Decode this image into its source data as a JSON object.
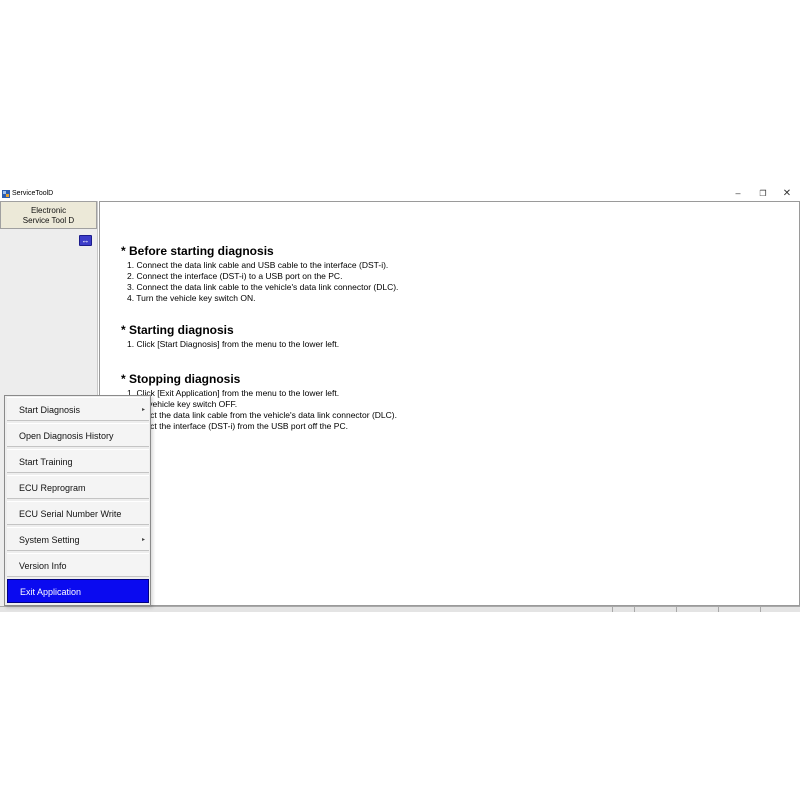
{
  "window": {
    "title": "ServiceToolD",
    "minimize_glyph": "–",
    "maximize_glyph": "❐",
    "close_glyph": "✕"
  },
  "sidebar": {
    "header_line1": "Electronic",
    "header_line2": "Service Tool D",
    "toggle_glyph": "↔"
  },
  "content": {
    "sections": [
      {
        "heading": "* Before starting diagnosis",
        "steps": [
          "1. Connect the data link cable and USB cable to the interface (DST-i).",
          "2. Connect the interface (DST-i) to a USB port on the PC.",
          "3. Connect the data link cable to the vehicle's data link connector (DLC).",
          "4. Turn the vehicle key switch ON."
        ]
      },
      {
        "heading": "* Starting diagnosis",
        "steps": [
          "1. Click [Start Diagnosis] from the menu to the lower left."
        ]
      },
      {
        "heading": "* Stopping diagnosis",
        "steps": [
          "1. Click [Exit Application] from the menu to the lower left.",
          "n the vehicle key switch OFF.",
          "connect the data link cable from the vehicle's data link connector (DLC).",
          "connect the interface (DST-i) from the USB port off the PC."
        ]
      }
    ]
  },
  "menu": {
    "items": [
      {
        "label": "Start Diagnosis",
        "submenu": "▸"
      },
      {
        "label": "Open Diagnosis History"
      },
      {
        "label": "Start Training"
      },
      {
        "label": "ECU Reprogram"
      },
      {
        "label": "ECU Serial Number Write"
      },
      {
        "label": "System Setting",
        "submenu": "▸"
      },
      {
        "label": "Version Info"
      },
      {
        "label": "Exit Application",
        "active": true
      }
    ]
  },
  "colors": {
    "menu_highlight": "#0a0af0",
    "sidebar_bg": "#ededed",
    "toggle_icon": "#3c3cc8"
  },
  "icons": [
    "app-icon",
    "minimize-icon",
    "maximize-icon",
    "close-icon",
    "toggle-panel-icon",
    "submenu-arrow-icon"
  ]
}
